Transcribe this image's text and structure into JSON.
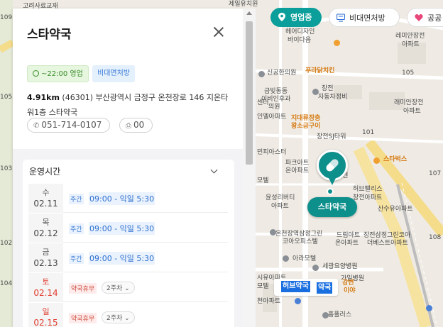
{
  "map": {
    "labels": [
      {
        "text": "고려사료교재",
        "cls": ""
      },
      {
        "text": "제일유치원",
        "cls": ""
      },
      {
        "text": "헤어디자인",
        "cls": ""
      },
      {
        "text": "바이다음",
        "cls": ""
      },
      {
        "text": "레미안장전",
        "cls": ""
      },
      {
        "text": "아파트",
        "cls": ""
      },
      {
        "text": "신공한의원",
        "cls": ""
      },
      {
        "text": "푸라닭치킨",
        "cls": "orange"
      },
      {
        "text": "금빛동동",
        "cls": ""
      },
      {
        "text": "이비인후과",
        "cls": ""
      },
      {
        "text": "의원",
        "cls": ""
      },
      {
        "text": "장전",
        "cls": ""
      },
      {
        "text": "자동차정비",
        "cls": ""
      },
      {
        "text": "지대류장충",
        "cls": "orange"
      },
      {
        "text": "왕소금구이",
        "cls": "orange"
      },
      {
        "text": "센터",
        "cls": ""
      },
      {
        "text": "래미안장전",
        "cls": ""
      },
      {
        "text": "아파트",
        "cls": ""
      },
      {
        "text": "인엘아파트",
        "cls": ""
      },
      {
        "text": "장전SJ타워",
        "cls": ""
      },
      {
        "text": "스타벅스",
        "cls": "orange"
      },
      {
        "text": "민피아스터",
        "cls": ""
      },
      {
        "text": "파크아트",
        "cls": ""
      },
      {
        "text": "온아파트",
        "cls": ""
      },
      {
        "text": "센",
        "cls": ""
      },
      {
        "text": "모텔",
        "cls": ""
      },
      {
        "text": "윤성리버티",
        "cls": ""
      },
      {
        "text": "아파트",
        "cls": ""
      },
      {
        "text": "허브팰리스",
        "cls": ""
      },
      {
        "text": "장전아파트",
        "cls": ""
      },
      {
        "text": "산수유아파트",
        "cls": ""
      },
      {
        "text": "온천장역삼정그린",
        "cls": ""
      },
      {
        "text": "코아오피스텔",
        "cls": ""
      },
      {
        "text": "드림아트",
        "cls": ""
      },
      {
        "text": "온아파트",
        "cls": ""
      },
      {
        "text": "장전삼정그린코아",
        "cls": ""
      },
      {
        "text": "더베스트아파트",
        "cls": ""
      },
      {
        "text": "아라모텔",
        "cls": ""
      },
      {
        "text": "세광요양병원",
        "cls": ""
      },
      {
        "text": "시유아파트",
        "cls": ""
      },
      {
        "text": "가일병원",
        "cls": ""
      },
      {
        "text": "모텔",
        "cls": ""
      },
      {
        "text": "천아파트",
        "cls": ""
      },
      {
        "text": "홈플러스",
        "cls": ""
      },
      {
        "text": "강변",
        "cls": "orange"
      },
      {
        "text": "이야",
        "cls": "orange"
      },
      {
        "text": "109",
        "cls": ""
      },
      {
        "text": "105",
        "cls": ""
      },
      {
        "text": "103",
        "cls": ""
      },
      {
        "text": "102",
        "cls": ""
      },
      {
        "text": "104",
        "cls": ""
      },
      {
        "text": "106",
        "cls": ""
      },
      {
        "text": "107",
        "cls": ""
      },
      {
        "text": "108",
        "cls": ""
      },
      {
        "text": "101",
        "cls": ""
      },
      {
        "text": "105",
        "cls": ""
      }
    ]
  },
  "chips": {
    "open": "영업중",
    "tele": "비대면처방",
    "pub": "공공"
  },
  "marker": {
    "label": "스타약국",
    "highlight1": "허브약국",
    "highlight2": "약국"
  },
  "panel": {
    "title": "스타약국",
    "tag_hours": "~22:00 영업",
    "tag_tele": "비대면처방",
    "distance": "4.91km",
    "postcode": "(46301)",
    "address": "부산광역시 금정구 온천장로 146 지온타워1층 스타약국",
    "phone": "051-714-0107",
    "fax": "00",
    "hours_title": "운영시간",
    "hours": [
      {
        "day": "수",
        "date": "02.11",
        "kind": "주간",
        "time": "09:00 - 익일 5:30",
        "closed": false
      },
      {
        "day": "목",
        "date": "02.12",
        "kind": "주간",
        "time": "09:00 - 익일 5:30",
        "closed": false
      },
      {
        "day": "금",
        "date": "02.13",
        "kind": "주간",
        "time": "09:00 - 익일 5:30",
        "closed": false
      },
      {
        "day": "토",
        "date": "02.14",
        "kind": "약국휴무",
        "time": "2주차",
        "closed": true
      },
      {
        "day": "일",
        "date": "02.15",
        "kind": "약국휴무",
        "time": "2주차",
        "closed": true
      }
    ]
  },
  "colors": {
    "accent": "#0d8f8c",
    "closed_red": "#e0392b",
    "link_blue": "#2b6fd0"
  }
}
